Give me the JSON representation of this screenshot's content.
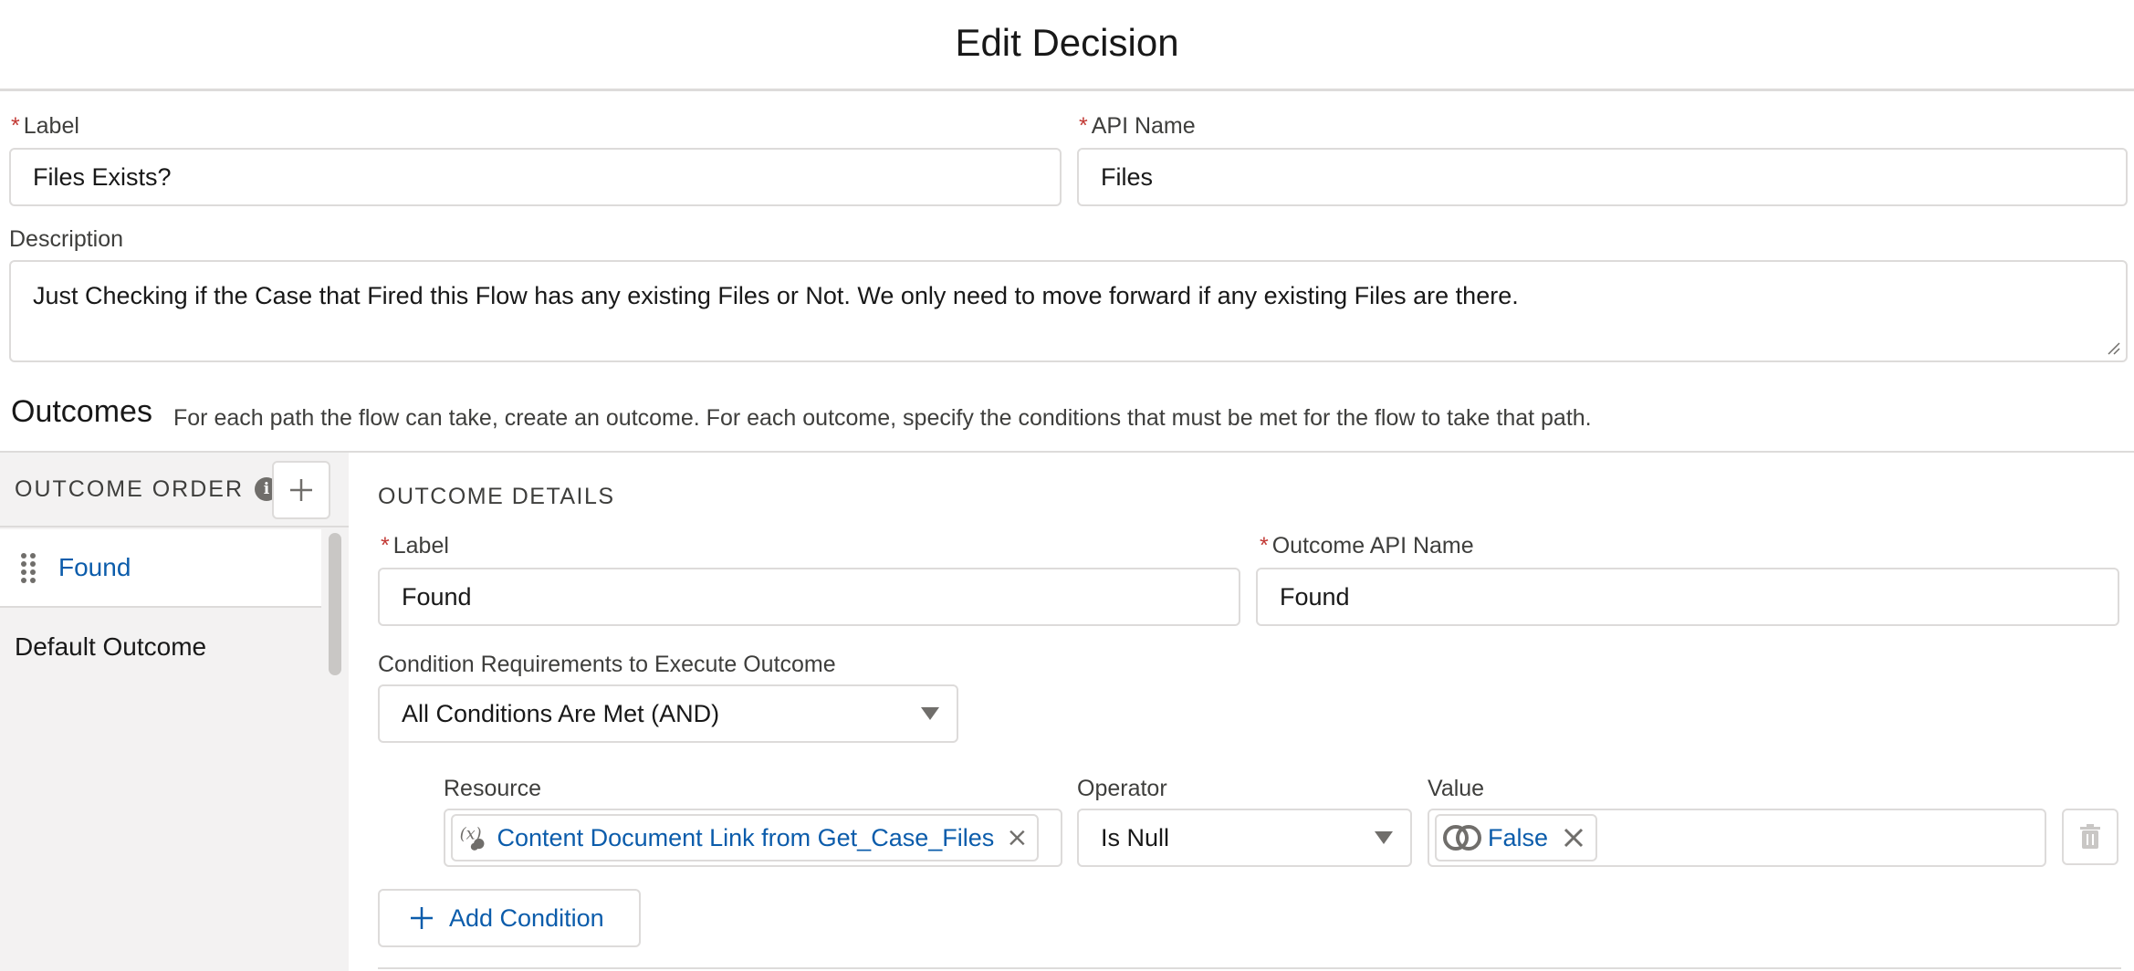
{
  "modal": {
    "title": "Edit Decision"
  },
  "form": {
    "required_marker": "*",
    "label": {
      "label": "Label",
      "value": "Files Exists?"
    },
    "api_name": {
      "label": "API Name",
      "value": "Files"
    },
    "description": {
      "label": "Description",
      "value": "Just Checking if the Case that Fired this Flow has any existing Files or Not. We only need to move forward if any existing Files are there."
    }
  },
  "outcomes": {
    "title": "Outcomes",
    "description": "For each path the flow can take, create an outcome. For each outcome, specify the conditions that must be met for the flow to take that path."
  },
  "sidebar": {
    "order_title": "OUTCOME ORDER",
    "items": [
      {
        "label": "Found",
        "active": true
      },
      {
        "label": "Default Outcome",
        "active": false
      }
    ]
  },
  "details": {
    "title": "OUTCOME DETAILS",
    "label": {
      "label": "Label",
      "value": "Found"
    },
    "api_name": {
      "label": "Outcome API Name",
      "value": "Found"
    },
    "condition_requirements": {
      "label": "Condition Requirements to Execute Outcome",
      "value": "All Conditions Are Met (AND)"
    },
    "condition": {
      "resource_label": "Resource",
      "resource_value": "Content Document Link from Get_Case_Files",
      "operator_label": "Operator",
      "operator_value": "Is Null",
      "value_label": "Value",
      "value_value": "False"
    },
    "add_condition_label": "Add Condition"
  },
  "colors": {
    "link": "#0b5cab",
    "required": "#c23934",
    "border": "#dddbda",
    "sidebar_bg": "#f3f2f2"
  }
}
